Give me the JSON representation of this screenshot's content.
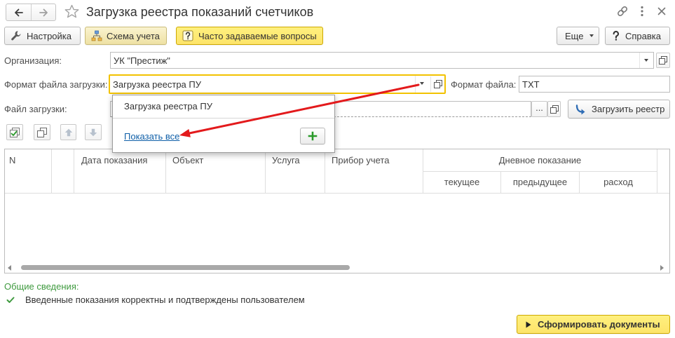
{
  "window": {
    "title": "Загрузка реестра показаний счетчиков"
  },
  "toolbar": {
    "settings": {
      "label": "Настройка",
      "icon": "wrench-icon"
    },
    "scheme": {
      "label": "Схема учета",
      "icon": "hierarchy-icon"
    },
    "faq": {
      "label": "Часто задаваемые вопросы",
      "icon": "question-icon"
    },
    "more": {
      "label": "Еще"
    },
    "help": {
      "label": "Справка",
      "icon": "question-icon"
    }
  },
  "form": {
    "organization": {
      "label": "Организация:",
      "value": "УК \"Престиж\""
    },
    "load_format": {
      "label": "Формат файла загрузки:",
      "value": "Загрузка реестра ПУ"
    },
    "file_format": {
      "label": "Формат файла:",
      "value": "TXT"
    },
    "load_file": {
      "label": "Файл загрузки:",
      "value": "",
      "select_label": "..."
    },
    "load_button": {
      "label": "Загрузить реестр",
      "icon": "import-arrow-icon"
    }
  },
  "format_dropdown": {
    "items": [
      "Загрузка реестра ПУ"
    ],
    "show_all": "Показать все",
    "add_icon": "plus-icon"
  },
  "table": {
    "columns": [
      "N",
      "Дата показания",
      "Объект",
      "Услуга",
      "Прибор учета"
    ],
    "group": {
      "label": "Дневное показание",
      "subcolumns": [
        "текущее",
        "предыдущее",
        "расход"
      ]
    },
    "rows": []
  },
  "summary": {
    "heading": "Общие сведения:",
    "status": "Введенные показания корректны и подтверждены пользователем"
  },
  "footer": {
    "create_documents": "Сформировать документы"
  },
  "colors": {
    "accent_yellow": "#fde46a",
    "focus_border": "#f2c200",
    "link": "#0f5fa8",
    "status_green": "#3f9a3f",
    "annotation_red": "#e31a1c"
  }
}
